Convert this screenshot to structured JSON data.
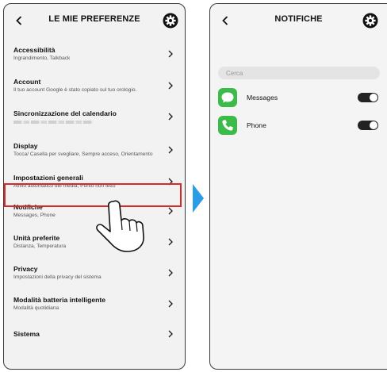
{
  "left_screen": {
    "title": "LE MIE PREFERENZE",
    "back_icon": "chevron-left-icon",
    "settings_icon": "gear-icon",
    "items": [
      {
        "title": "Accessibilità",
        "subtitle": "Ingrandimento, Talkback"
      },
      {
        "title": "Account",
        "subtitle": "Il tuo account Google è stato copiato sul tuo orologio."
      },
      {
        "title": "Sincronizzazione del calendario",
        "subtitle": ""
      },
      {
        "title": "Display",
        "subtitle": "Tocca/ Casella per svegliare, Sempre acceso, Orientamento"
      },
      {
        "title": "Impostazioni generali",
        "subtitle": "Avvio automatico dei media, Punto non letto"
      },
      {
        "title": "Notifiche",
        "subtitle": "Messages, Phone"
      },
      {
        "title": "Unità preferite",
        "subtitle": "Distanza, Temperatura"
      },
      {
        "title": "Privacy",
        "subtitle": "Impostazioni della privacy del sistema"
      },
      {
        "title": "Modalità batteria intelligente",
        "subtitle": "Modalità quotidiana"
      },
      {
        "title": "Sistema",
        "subtitle": ""
      }
    ],
    "highlighted_item": "Notifiche"
  },
  "right_screen": {
    "title": "NOTIFICHE",
    "back_icon": "chevron-left-icon",
    "settings_icon": "gear-icon",
    "search_placeholder": "Cerca",
    "apps": [
      {
        "name": "Messages",
        "icon": "messages-icon",
        "color": "#3dbb4a",
        "enabled": true
      },
      {
        "name": "Phone",
        "icon": "phone-icon",
        "color": "#3dbb4a",
        "enabled": true
      }
    ]
  },
  "colors": {
    "highlight_border": "#d52a2a",
    "transition_arrow": "#2b9ce6",
    "toggle_on": "#222222"
  }
}
